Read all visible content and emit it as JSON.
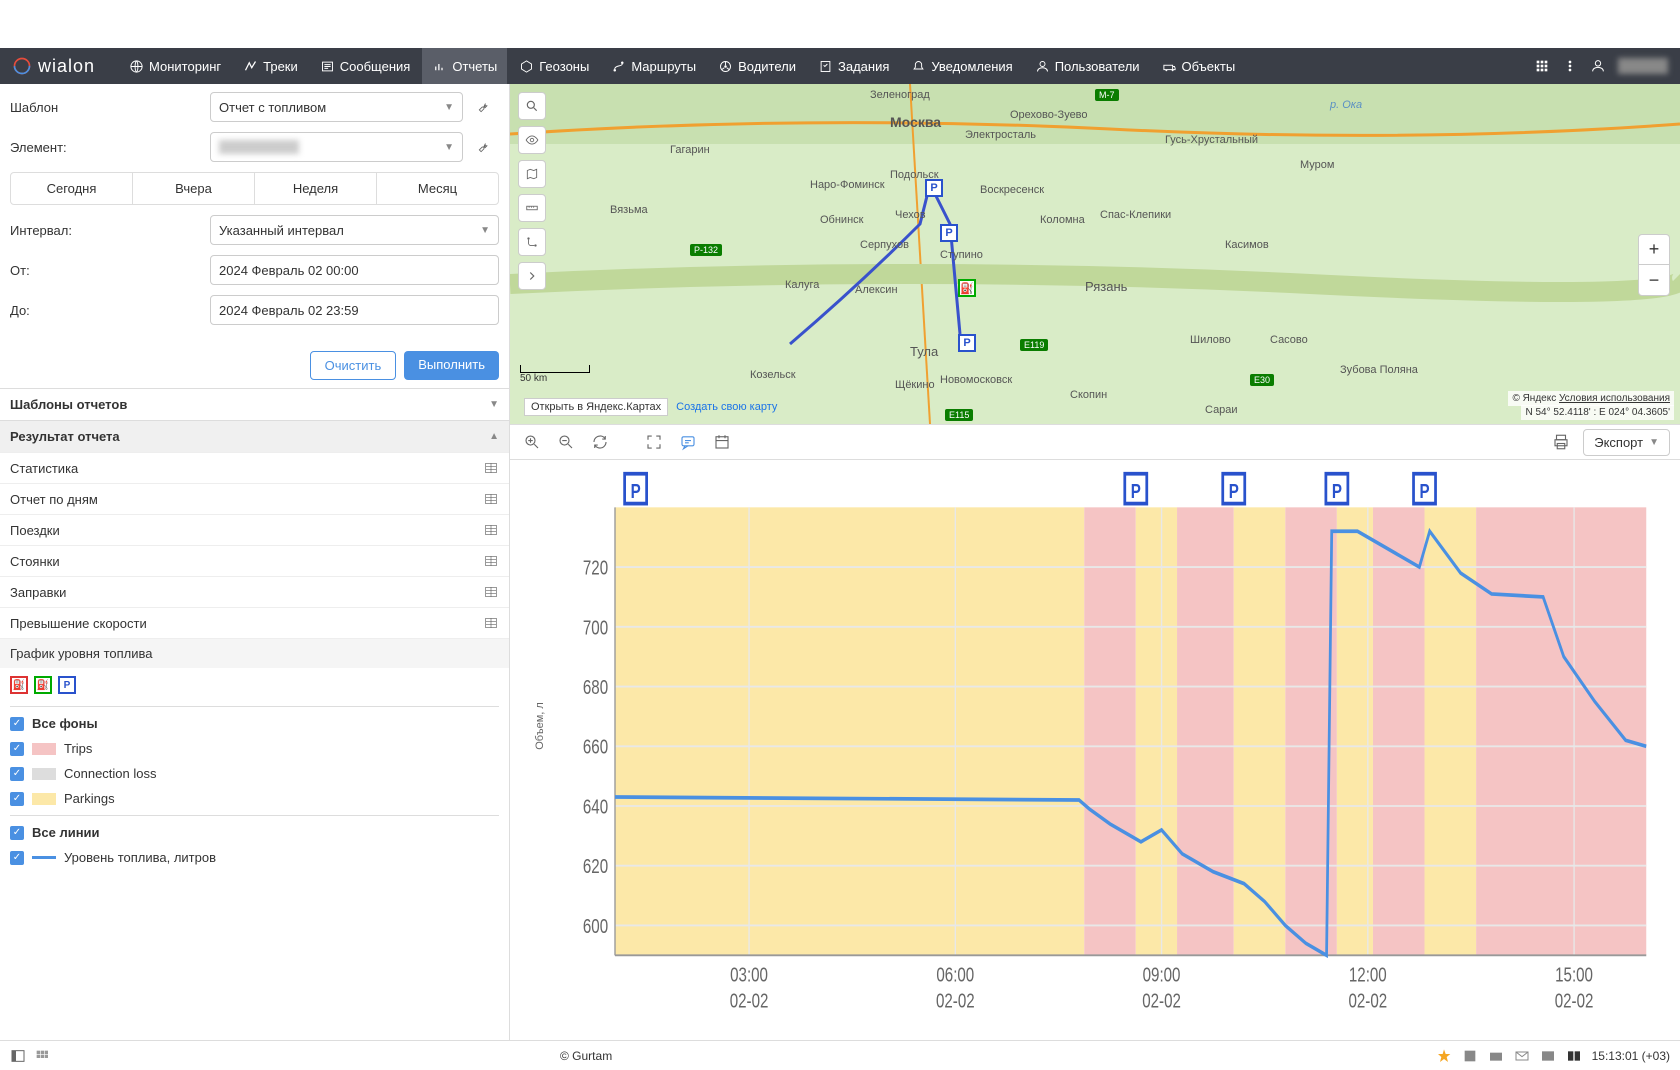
{
  "app_name": "wialon",
  "nav": {
    "monitoring": "Мониторинг",
    "tracks": "Треки",
    "messages": "Сообщения",
    "reports": "Отчеты",
    "geofences": "Геозоны",
    "routes": "Маршруты",
    "drivers": "Водители",
    "jobs": "Задания",
    "notifications": "Уведомления",
    "users": "Пользователи",
    "units": "Объекты"
  },
  "form": {
    "template_label": "Шаблон",
    "template_value": "Отчет с топливом",
    "element_label": "Элемент:",
    "period_today": "Сегодня",
    "period_yesterday": "Вчера",
    "period_week": "Неделя",
    "period_month": "Месяц",
    "interval_label": "Интервал:",
    "interval_value": "Указанный интервал",
    "from_label": "От:",
    "from_value": "2024 Февраль 02 00:00",
    "to_label": "До:",
    "to_value": "2024 Февраль 02 23:59",
    "clear_btn": "Очистить",
    "execute_btn": "Выполнить"
  },
  "accordion": {
    "templates": "Шаблоны отчетов",
    "result": "Результат отчета",
    "items": {
      "stats": "Статистика",
      "daily": "Отчет по дням",
      "trips": "Поездки",
      "parkings": "Стоянки",
      "fillings": "Заправки",
      "speeding": "Превышение скорости",
      "fuel_chart": "График уровня топлива"
    }
  },
  "legend": {
    "all_bg": "Все фоны",
    "trips": "Trips",
    "conn_loss": "Connection loss",
    "parkings": "Parkings",
    "all_lines": "Все линии",
    "fuel_level": "Уровень топлива, литров"
  },
  "map": {
    "scale": "50 km",
    "open_yandex": "Открыть в Яндекс.Картах",
    "create_map": "Создать свою карту",
    "attribution_prefix": "© Яндекс ",
    "attribution_link": "Условия использования",
    "coords": "N 54° 52.4118' : E 024° 04.3605'",
    "cities": {
      "moscow": "Москва",
      "zelenograd": "Зеленоград",
      "orehovo": "Орехово-Зуево",
      "elektrostal": "Электросталь",
      "podolsk": "Подольск",
      "voskresensk": "Воскресенск",
      "kolomna": "Коломна",
      "naro": "Наро-Фоминск",
      "chehov": "Чехов",
      "obninsk": "Обнинск",
      "serpuhov": "Серпухов",
      "stupino": "Ступино",
      "ryazan": "Рязань",
      "kaluga": "Калуга",
      "aleksin": "Алексин",
      "tula": "Тула",
      "novomoskovsk": "Новомосковск",
      "schekino": "Щёкино",
      "kozelsky": "Козельск",
      "gagarin": "Гагарин",
      "vyazma": "Вязьма",
      "gus": "Гусь-Хрустальный",
      "murom": "Муром",
      "kasimov": "Касимов",
      "spas": "Спас-Клепики",
      "shilovo": "Шилово",
      "sasovo": "Сасово",
      "zubova": "Зубова Поляна",
      "sarai": "Сараи",
      "skopin": "Скопин",
      "oka": "р. Ока"
    }
  },
  "chart_toolbar": {
    "export": "Экспорт"
  },
  "chart_data": {
    "type": "line",
    "title": "",
    "xlabel": "",
    "ylabel": "Объем, л",
    "ylim": [
      590,
      740
    ],
    "y_ticks": [
      600,
      620,
      640,
      660,
      680,
      700,
      720
    ],
    "x_ticks": [
      {
        "time": "03:00",
        "date": "02-02"
      },
      {
        "time": "06:00",
        "date": "02-02"
      },
      {
        "time": "09:00",
        "date": "02-02"
      },
      {
        "time": "12:00",
        "date": "02-02"
      },
      {
        "time": "15:00",
        "date": "02-02"
      }
    ],
    "series": [
      {
        "name": "Уровень топлива, литров",
        "color": "#4a90e2",
        "points": [
          {
            "x": 0.0,
            "y": 643
          },
          {
            "x": 0.45,
            "y": 642
          },
          {
            "x": 0.46,
            "y": 639
          },
          {
            "x": 0.48,
            "y": 634
          },
          {
            "x": 0.51,
            "y": 628
          },
          {
            "x": 0.53,
            "y": 632
          },
          {
            "x": 0.55,
            "y": 624
          },
          {
            "x": 0.58,
            "y": 618
          },
          {
            "x": 0.61,
            "y": 614
          },
          {
            "x": 0.63,
            "y": 608
          },
          {
            "x": 0.65,
            "y": 600
          },
          {
            "x": 0.67,
            "y": 594
          },
          {
            "x": 0.69,
            "y": 590
          },
          {
            "x": 0.695,
            "y": 732
          },
          {
            "x": 0.72,
            "y": 732
          },
          {
            "x": 0.78,
            "y": 720
          },
          {
            "x": 0.79,
            "y": 732
          },
          {
            "x": 0.82,
            "y": 718
          },
          {
            "x": 0.85,
            "y": 711
          },
          {
            "x": 0.9,
            "y": 710
          },
          {
            "x": 0.92,
            "y": 690
          },
          {
            "x": 0.95,
            "y": 675
          },
          {
            "x": 0.98,
            "y": 662
          },
          {
            "x": 1.0,
            "y": 660
          }
        ]
      }
    ],
    "backgrounds": [
      {
        "type": "parking",
        "color": "#fce8a8",
        "x0": 0.0,
        "x1": 0.455
      },
      {
        "type": "trip",
        "color": "#f5c4c4",
        "x0": 0.455,
        "x1": 0.505
      },
      {
        "type": "parking",
        "color": "#fce8a8",
        "x0": 0.505,
        "x1": 0.545
      },
      {
        "type": "trip",
        "color": "#f5c4c4",
        "x0": 0.545,
        "x1": 0.6
      },
      {
        "type": "parking",
        "color": "#fce8a8",
        "x0": 0.6,
        "x1": 0.65
      },
      {
        "type": "trip",
        "color": "#f5c4c4",
        "x0": 0.65,
        "x1": 0.7
      },
      {
        "type": "parking",
        "color": "#fce8a8",
        "x0": 0.7,
        "x1": 0.735
      },
      {
        "type": "trip",
        "color": "#f5c4c4",
        "x0": 0.735,
        "x1": 0.785
      },
      {
        "type": "parking",
        "color": "#fce8a8",
        "x0": 0.785,
        "x1": 0.835
      },
      {
        "type": "trip",
        "color": "#f5c4c4",
        "x0": 0.835,
        "x1": 1.0
      }
    ],
    "parking_markers_x": [
      0.02,
      0.505,
      0.6,
      0.7,
      0.785
    ]
  },
  "footer": {
    "gurtam": "© Gurtam",
    "time": "15:13:01 (+03)"
  }
}
